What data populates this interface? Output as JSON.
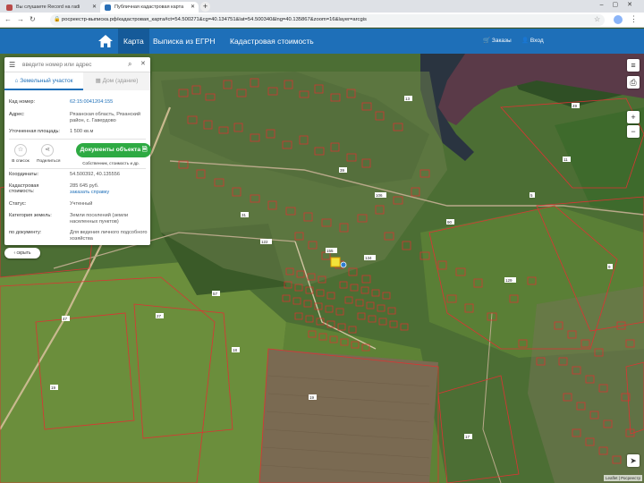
{
  "browser": {
    "tabs": [
      {
        "title": "Вы слушаете Record на radi",
        "active": false
      },
      {
        "title": "Публичная кадастровая карта",
        "active": true
      }
    ],
    "url": "росреестр-выписка.рф/кадастровая_карта#ct=54.500271&cg=40.134751&lat=54.500340&lng=40.135867&zoom=16&layer=arcgis"
  },
  "site": {
    "nav": [
      "Карта",
      "Выписка из ЕГРН",
      "Кадастровая стоимость"
    ],
    "orders_label": "Заказы",
    "login_label": "Вход"
  },
  "panel": {
    "search_placeholder": "введите номер или адрес",
    "tab_parcel": "Земельный участок",
    "tab_building": "Дом (здание)",
    "fields": {
      "cad_label": "Кад номер:",
      "cad_value": "62:15:0041204:155",
      "address_label": "Адрес:",
      "address_value": "Рязанская область, Рязанский район, с. Гавердово",
      "area_label": "Уточненная площадь:",
      "area_value": "1 500 кв.м",
      "coords_label": "Координаты:",
      "coords_value": "54.500392, 40.135556",
      "cost_label": "Кадастровая стоимость:",
      "cost_value": "285 645 руб.",
      "cost_link": "заказать справку",
      "status_label": "Статус:",
      "status_value": "Учтенный",
      "category_label": "Категория земель:",
      "category_value": "Земли поселений (земли населенных пунктов)",
      "use_label": "по документу:",
      "use_value": "Для ведения личного подсобного хозяйства"
    },
    "actions": {
      "save_label": "В список",
      "share_label": "Поделиться",
      "doc_button": "Документы объекта",
      "doc_sub": "Собственник, стоимость и др."
    },
    "hide_label": "скрыть"
  },
  "map": {
    "parcel_numbers": [
      "13",
      "5",
      "11",
      "9",
      "47",
      "27",
      "18",
      "19",
      "19",
      "17",
      "31",
      "57",
      "49",
      "122",
      "134",
      "129",
      "106",
      "90",
      "39",
      "155"
    ],
    "attribution": "Leaflet | Росреестр"
  }
}
